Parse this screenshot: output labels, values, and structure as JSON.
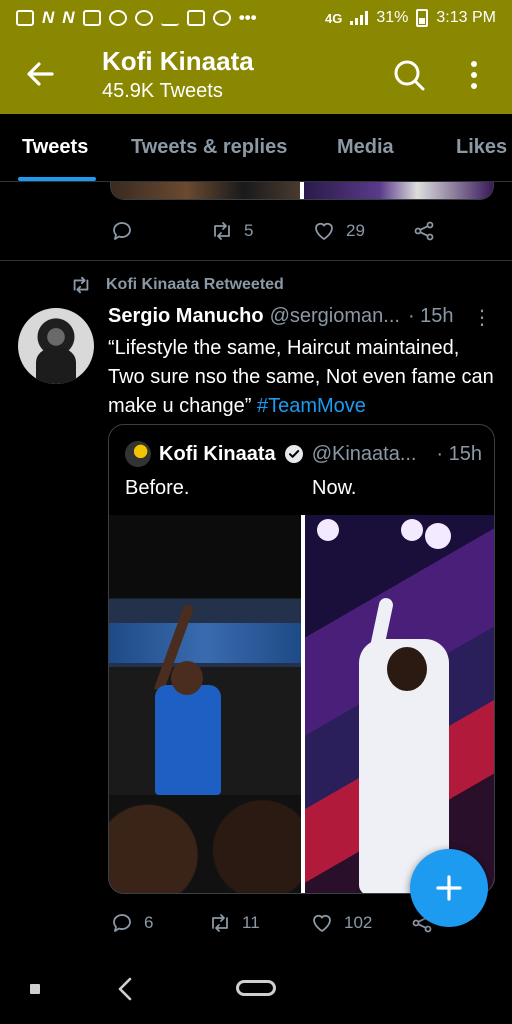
{
  "status_bar": {
    "left_icons": [
      "gallery-icon",
      "n-icon",
      "n-icon",
      "youtube-icon",
      "tiktok-icon",
      "facebook-icon",
      "upload-icon",
      "linkedin-icon",
      "shield-icon",
      "more-dots-icon"
    ],
    "network": "4G",
    "battery": "31%",
    "time": "3:13 PM"
  },
  "header": {
    "title": "Kofi Kinaata",
    "subtitle": "45.9K Tweets",
    "bg_color": "#8a8700"
  },
  "tabs": [
    {
      "label": "Tweets",
      "active": true
    },
    {
      "label": "Tweets & replies",
      "active": false
    },
    {
      "label": "Media",
      "active": false
    },
    {
      "label": "Likes",
      "active": false
    }
  ],
  "prev_tweet": {
    "retweets": "5",
    "likes": "29"
  },
  "tweet": {
    "retweeted_by": "Kofi Kinaata Retweeted",
    "author_name": "Sergio Manucho",
    "author_handle": "@sergioman...",
    "time": "· 15h",
    "more": "⋮",
    "text_main": "“Lifestyle the same, Haircut maintained, Two sure nso the same, Not even fame can make u change”",
    "hashtag": "#TeamMove",
    "quote": {
      "name": "Kofi Kinaata",
      "handle": "@Kinaata...",
      "time": "· 15h",
      "before": "Before.",
      "now": "Now."
    },
    "replies": "6",
    "retweets": "11",
    "likes": "102"
  },
  "accent_color": "#1d9bf0"
}
